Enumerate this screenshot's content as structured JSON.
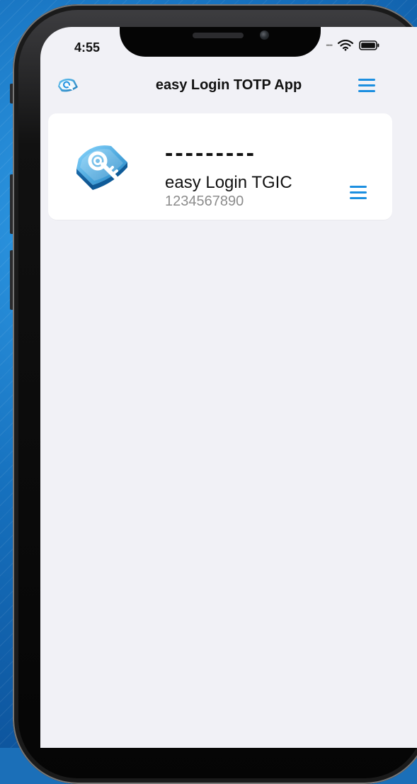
{
  "status_bar": {
    "time": "4:55",
    "signal_icon": "signal-icon",
    "wifi_icon": "wifi-icon",
    "battery_icon": "battery-icon"
  },
  "header": {
    "logo_icon": "app-logo-icon",
    "title": "easy Login TOTP App",
    "menu_icon": "menu-icon"
  },
  "account_card": {
    "logo_icon": "account-logo-icon",
    "otp": "---------",
    "name": "easy Login TGIC",
    "id": "1234567890",
    "menu_icon": "menu-icon"
  },
  "colors": {
    "accent": "#1c8fe0",
    "background": "#f1f1f6",
    "card": "#ffffff"
  }
}
